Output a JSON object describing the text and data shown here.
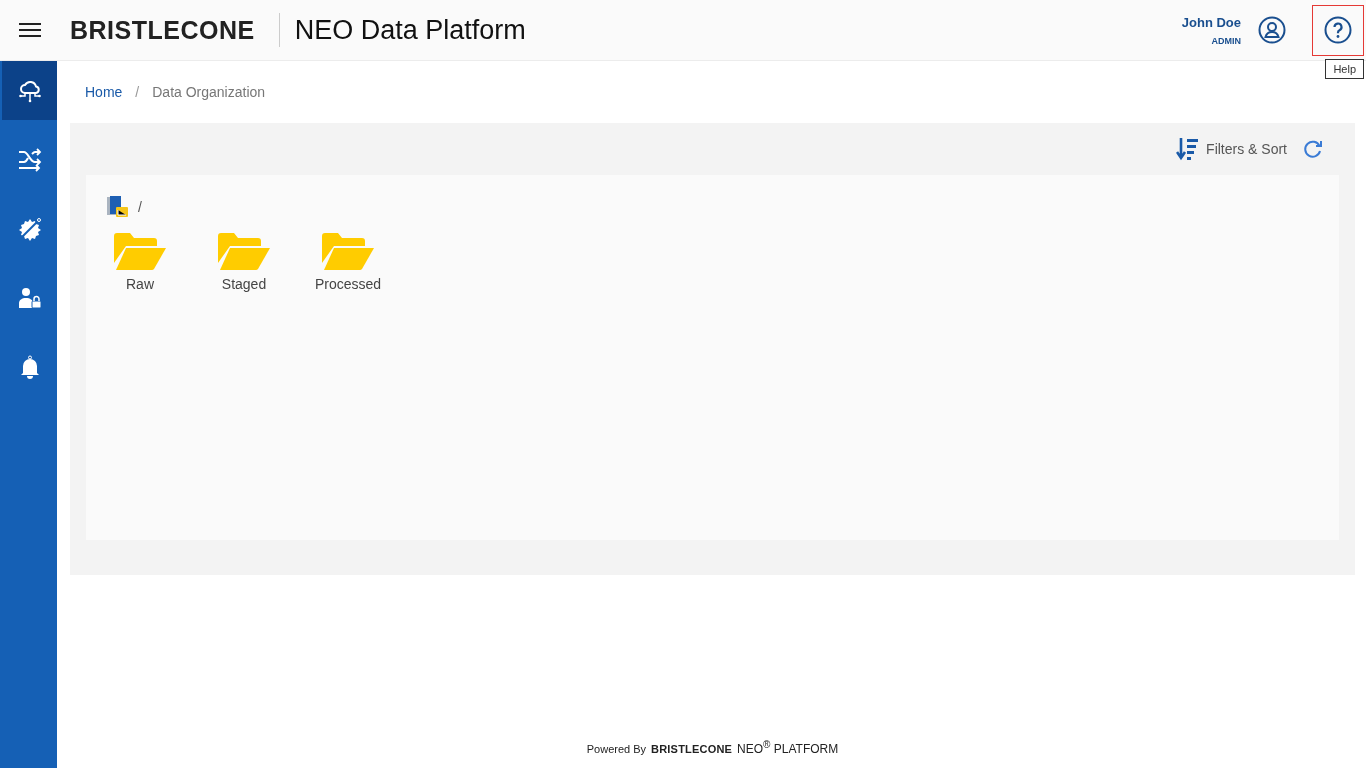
{
  "header": {
    "logo": "BRISTLECONE",
    "title": "NEO Data Platform",
    "user": {
      "name": "John Doe",
      "role": "ADMIN"
    },
    "help_tooltip": "Help"
  },
  "sidebar": {
    "items": [
      {
        "kind": "cloud",
        "selected": true
      },
      {
        "kind": "flows",
        "selected": false
      },
      {
        "kind": "gear",
        "selected": false
      },
      {
        "kind": "user-lock",
        "selected": false
      },
      {
        "kind": "bell",
        "selected": false
      }
    ]
  },
  "breadcrumb": [
    {
      "label": "Home",
      "current": false
    },
    {
      "separator": "/"
    },
    {
      "label": "Data Organization",
      "current": true
    }
  ],
  "toolbar": {
    "filters_label": "Filters & Sort"
  },
  "path": "/",
  "folders": [
    {
      "name": "Raw"
    },
    {
      "name": "Staged"
    },
    {
      "name": "Processed"
    }
  ],
  "footer": {
    "powered": "Powered By",
    "logo": "BRISTLECONE",
    "product": "NEO$^{®}$ PLATFORM"
  }
}
